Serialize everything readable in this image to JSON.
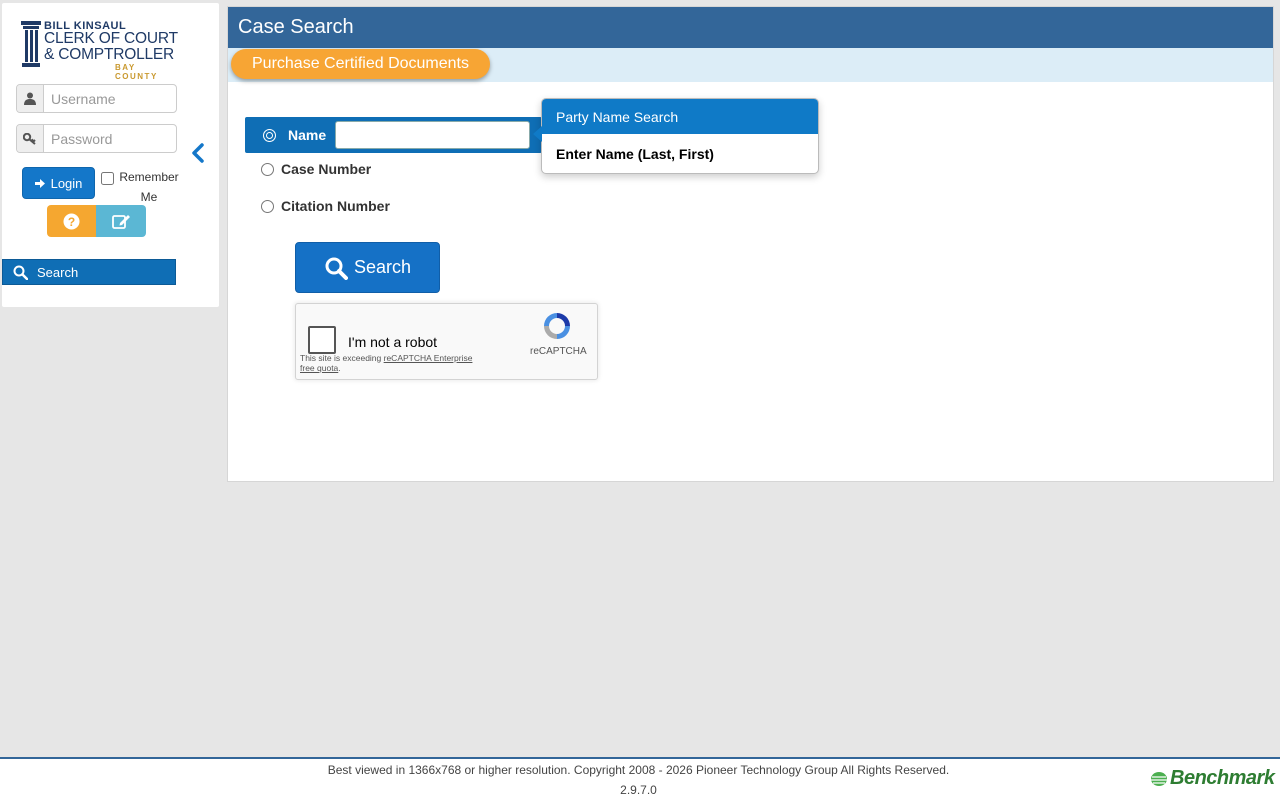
{
  "logo": {
    "line1": "BILL KINSAUL",
    "line2": "CLERK OF COURT",
    "line3": "& COMPTROLLER",
    "line4": "BAY COUNTY"
  },
  "login": {
    "username_placeholder": "Username",
    "password_placeholder": "Password",
    "login_label": "Login",
    "remember_label": "Remember Me"
  },
  "nav": {
    "search_label": "Search"
  },
  "panel": {
    "title": "Case Search",
    "purchase_label": "Purchase Certified Documents"
  },
  "search_options": {
    "name_label": "Name",
    "case_number_label": "Case Number",
    "citation_number_label": "Citation Number",
    "name_value": ""
  },
  "search_button_label": "Search",
  "recaptcha": {
    "label": "I'm not a robot",
    "note_prefix": "This site is exceeding ",
    "note_link": "reCAPTCHA Enterprise free quota",
    "brand": "reCAPTCHA"
  },
  "popover": {
    "title": "Party Name Search",
    "body": "Enter Name (Last, First)"
  },
  "footer": {
    "copyright": "Best viewed in 1366x768 or higher resolution. Copyright 2008 - 2026 Pioneer Technology Group All Rights Reserved.",
    "version": "2.9.7.0",
    "brand": "Benchmark"
  },
  "colors": {
    "header_blue": "#336699",
    "primary_blue": "#0f6eb5",
    "orange": "#f7a534",
    "teal": "#5bb7d4"
  }
}
